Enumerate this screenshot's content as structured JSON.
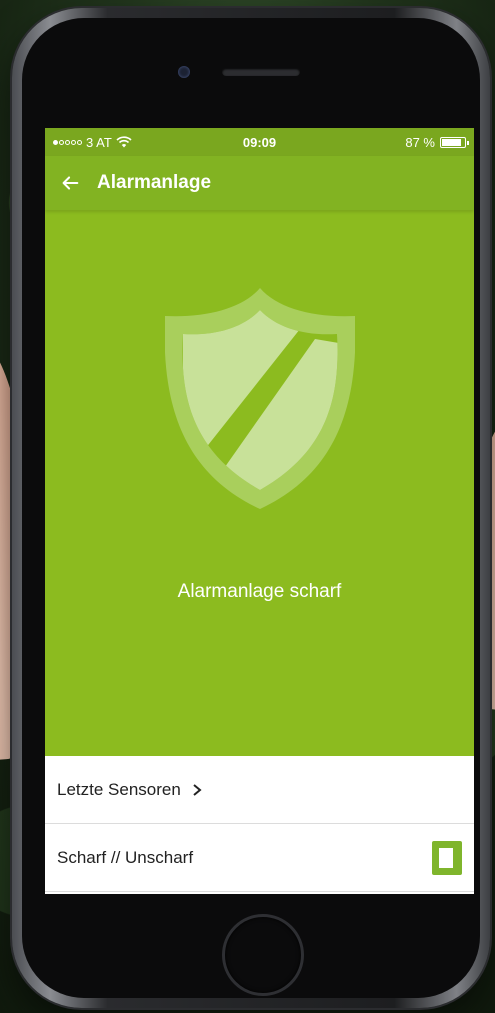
{
  "status_bar": {
    "carrier": "3 AT",
    "time": "09:09",
    "battery": "87 %",
    "battery_level": 0.87,
    "signal_strength": 1
  },
  "header": {
    "title": "Alarmanlage",
    "back_icon": "back-arrow-icon"
  },
  "main": {
    "status_text": "Alarmanlage scharf",
    "shield_icon": "shield-icon"
  },
  "rows": {
    "sensors_label": "Letzte Sensoren",
    "arm_label": "Scharf // Unscharf",
    "arm_state": "on"
  },
  "colors": {
    "accent": "#8cbb1f",
    "app_bar": "#82b322",
    "status_bar": "#7aa71f",
    "toggle": "#7fb52c"
  }
}
